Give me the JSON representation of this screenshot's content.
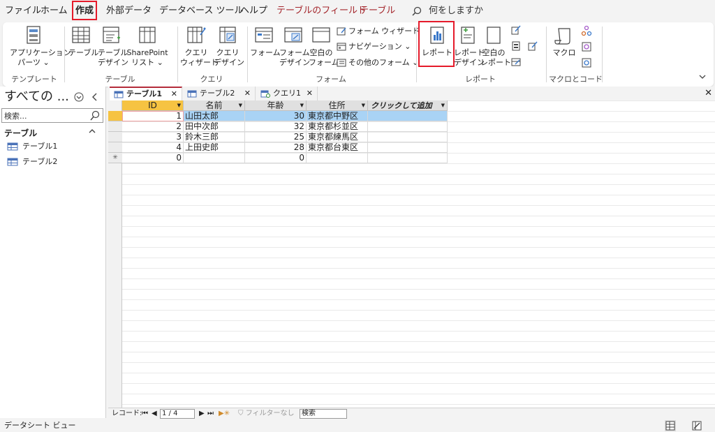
{
  "menu": {
    "tabs": [
      "ファイル",
      "ホーム",
      "作成",
      "外部データ",
      "データベース ツール",
      "ヘルプ",
      "テーブルのフィールド",
      "テーブル"
    ],
    "active_index": 2,
    "tell_me": "何をしますか"
  },
  "ribbon": {
    "template_app_parts": "アプリケーション",
    "template_app_parts2": "パーツ ⌄",
    "template_group": "テンプレート",
    "table_table": "テーブル",
    "table_design1": "テーブル",
    "table_design2": "デザイン",
    "table_sharepoint1": "SharePoint",
    "table_sharepoint2": "リスト ⌄",
    "table_group": "テーブル",
    "query_wizard1": "クエリ",
    "query_wizard2": "ウィザード",
    "query_design1": "クエリ",
    "query_design2": "デザイン",
    "query_group": "クエリ",
    "form_form": "フォーム",
    "form_design1": "フォーム",
    "form_design2": "デザイン",
    "form_blank1": "空白の",
    "form_blank2": "フォーム",
    "form_wizard": "フォーム ウィザード",
    "form_navigation": "ナビゲーション ⌄",
    "form_more": "その他のフォーム ⌄",
    "form_group": "フォーム",
    "report_report": "レポート",
    "report_design1": "レポート",
    "report_design2": "デザイン",
    "report_blank1": "空白の",
    "report_blank2": "レポート",
    "report_group": "レポート",
    "macro_macro": "マクロ",
    "macro_group": "マクロとコード"
  },
  "nav": {
    "title": "すべての ...",
    "search_placeholder": "検索...",
    "section": "テーブル",
    "items": [
      "テーブル1",
      "テーブル2"
    ]
  },
  "doc_tabs": [
    "テーブル1",
    "テーブル2",
    "クエリ1"
  ],
  "datasheet": {
    "headers": [
      "ID",
      "名前",
      "年齢",
      "住所",
      "クリックして追加"
    ],
    "rows": [
      {
        "id": "1",
        "name": "山田太郎",
        "age": "30",
        "address": "東京都中野区"
      },
      {
        "id": "2",
        "name": "田中次郎",
        "age": "32",
        "address": "東京都杉並区"
      },
      {
        "id": "3",
        "name": "鈴木三郎",
        "age": "25",
        "address": "東京都練馬区"
      },
      {
        "id": "4",
        "name": "上田史郎",
        "age": "28",
        "address": "東京都台東区"
      }
    ],
    "new_row": {
      "id": "0",
      "age": "0",
      "marker": "✳"
    }
  },
  "record_nav": {
    "label": "レコード:",
    "position": "1 / 4",
    "filter": "フィルターなし",
    "search": "検索"
  },
  "status": {
    "text": "データシート ビュー"
  },
  "colors": {
    "highlight_box": "#e51a2a",
    "tab_red": "#a4262c",
    "selected_row": "#a9d3f5",
    "id_header": "#f6c342"
  }
}
